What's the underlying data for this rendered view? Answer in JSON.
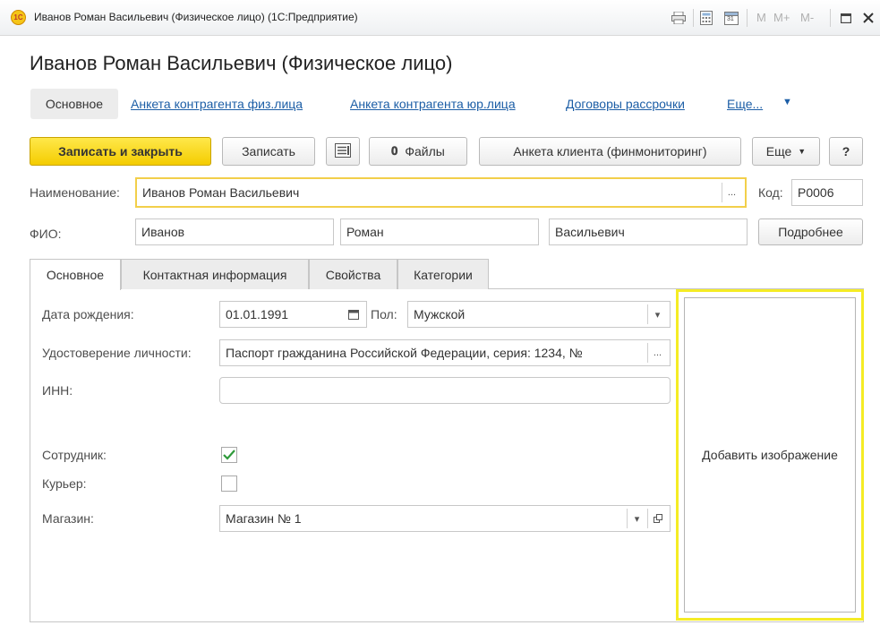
{
  "window": {
    "title": "Иванов Роман Васильевич (Физическое лицо) (1С:Предприятие)",
    "logo_text": "1С",
    "memory_buttons": [
      "M",
      "M+",
      "M-"
    ],
    "calendar_day": "31"
  },
  "page_title": "Иванов Роман Васильевич (Физическое лицо)",
  "nav": {
    "active": "Основное",
    "links": [
      "Анкета контрагента физ.лица",
      "Анкета контрагента юр.лица",
      "Договоры рассрочки"
    ],
    "more": "Еще..."
  },
  "toolbar": {
    "save_close": "Записать и закрыть",
    "save": "Записать",
    "files": "Файлы",
    "client_form": "Анкета клиента (финмониторинг)",
    "more": "Еще",
    "help": "?"
  },
  "header_fields": {
    "name_label": "Наименование:",
    "name_value": "Иванов Роман Васильевич",
    "code_label": "Код:",
    "code_value": "Р0006",
    "fio_label": "ФИО:",
    "last_name": "Иванов",
    "first_name": "Роман",
    "middle_name": "Васильевич",
    "details_button": "Подробнее"
  },
  "tabs": [
    "Основное",
    "Контактная информация",
    "Свойства",
    "Категории"
  ],
  "active_tab": "Основное",
  "main": {
    "birth_label": "Дата рождения:",
    "birth_value": "01.01.1991",
    "gender_label": "Пол:",
    "gender_value": "Мужской",
    "id_label": "Удостоверение личности:",
    "id_value": "Паспорт гражданина Российской Федерации, серия: 1234, №",
    "inn_label": "ИНН:",
    "inn_value": "",
    "employee_label": "Сотрудник:",
    "employee_checked": true,
    "courier_label": "Курьер:",
    "courier_checked": false,
    "store_label": "Магазин:",
    "store_value": "Магазин № 1",
    "add_image": "Добавить изображение"
  },
  "colors": {
    "primary_button": "#f4cc00",
    "link": "#1c5ea6",
    "focus_border": "#f2cf4a",
    "image_highlight": "#f5ec25",
    "checkmark": "#2e9a3a"
  }
}
